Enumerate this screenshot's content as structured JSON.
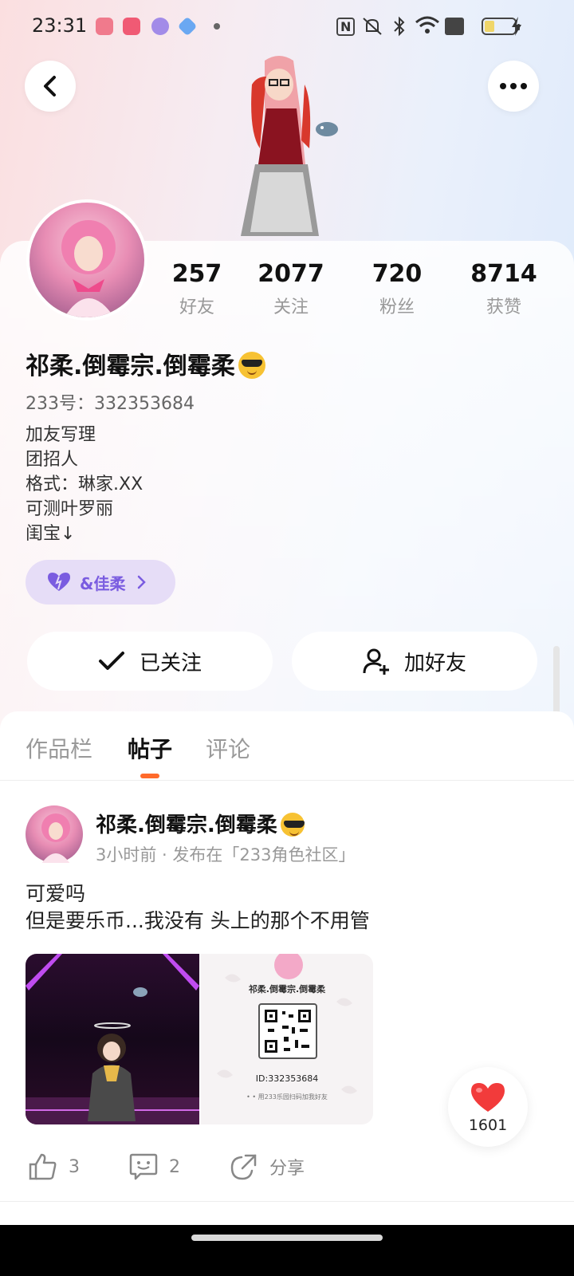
{
  "status_bar": {
    "time": "23:31",
    "nfc": "N",
    "battery_level": 0.3,
    "icons": [
      "music-app-icon",
      "video-app-icon",
      "chat-app-icon",
      "blue-app-icon",
      "dot-icon",
      "nfc-icon",
      "mute-icon",
      "bluetooth-icon",
      "wifi-icon",
      "sim-icon",
      "battery-icon",
      "charging-icon"
    ]
  },
  "header": {
    "back_icon": "back-arrow-icon",
    "more_icon": "more-dots-icon"
  },
  "profile": {
    "stats": [
      {
        "value": "257",
        "label": "好友"
      },
      {
        "value": "2077",
        "label": "关注"
      },
      {
        "value": "720",
        "label": "粉丝"
      },
      {
        "value": "8714",
        "label": "获赞"
      }
    ],
    "nickname": "祁柔.倒霉宗.倒霉柔",
    "uid": "233号：332353684",
    "bio": [
      "加友写理",
      "团招人",
      "格式：琳家.XX",
      "可测叶罗丽",
      "闺宝↓"
    ],
    "relation_pill": "&佳柔",
    "relation_color": "#7a5ce0"
  },
  "actions": {
    "followed_label": "已关注",
    "add_friend_label": "加好友"
  },
  "tabs": [
    {
      "label": "作品栏",
      "active": false
    },
    {
      "label": "帖子",
      "active": true
    },
    {
      "label": "评论",
      "active": false
    }
  ],
  "accent_color": "#ff6a2b",
  "post": {
    "author": "祁柔.倒霉宗.倒霉柔",
    "meta": "3小时前 · 发布在「233角色社区」",
    "text_lines": [
      "可爱吗",
      "但是要乐币...我没有 头上的那个不用管"
    ],
    "image2": {
      "name": "祁柔.倒霉宗.倒霉柔",
      "id": "ID:332353684",
      "hint": "• • 用233乐园扫码加我好友"
    },
    "like_count": "3",
    "comment_count": "2",
    "share_label": "分享"
  },
  "like_fab": {
    "count": "1601",
    "heart_color": "#f23b3b"
  }
}
